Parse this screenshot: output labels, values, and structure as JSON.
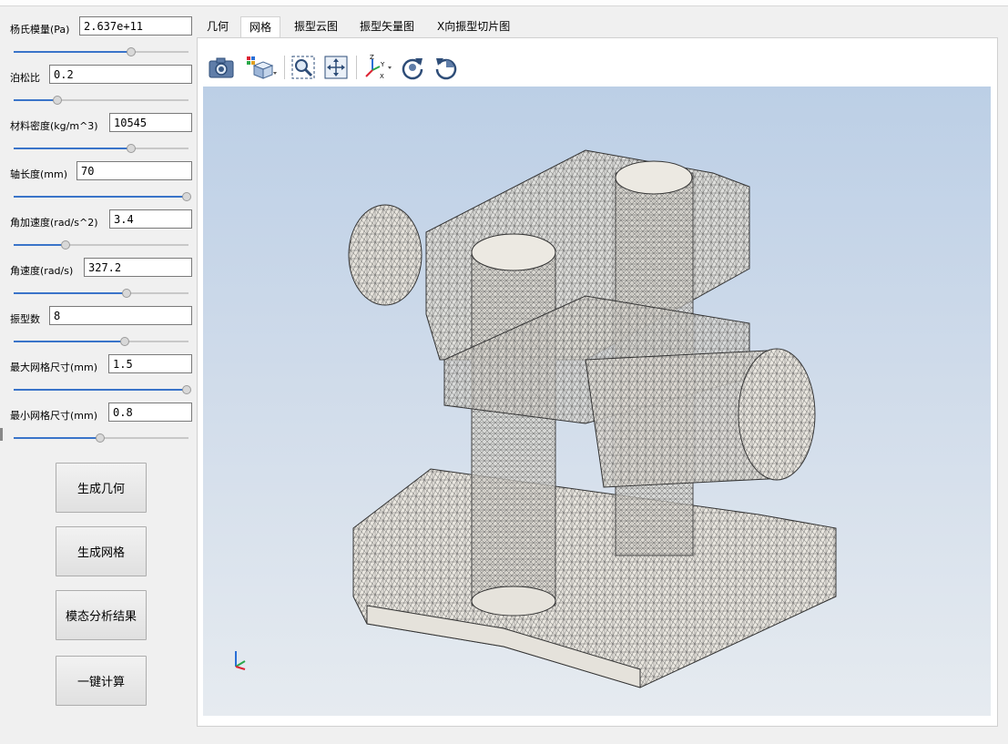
{
  "params": [
    {
      "label": "杨氏模量(Pa)",
      "value": "2.637e+11",
      "slider": 0.68
    },
    {
      "label": "泊松比",
      "value": "0.2",
      "slider": 0.25
    },
    {
      "label": "材料密度(kg/m^3)",
      "value": "10545",
      "slider": 0.68
    },
    {
      "label": "轴长度(mm)",
      "value": "70",
      "slider": 1.0
    },
    {
      "label": "角加速度(rad/s^2)",
      "value": "3.4",
      "slider": 0.3
    },
    {
      "label": "角速度(rad/s)",
      "value": "327.2",
      "slider": 0.65
    },
    {
      "label": "振型数",
      "value": "8",
      "slider": 0.64
    },
    {
      "label": "最大网格尺寸(mm)",
      "value": "1.5",
      "slider": 1.0
    },
    {
      "label": "最小网格尺寸(mm)",
      "value": "0.8",
      "slider": 0.5
    }
  ],
  "buttons": {
    "generate_geometry": "生成几何",
    "generate_mesh": "生成网格",
    "modal_results": "模态分析结果",
    "one_click": "一键计算"
  },
  "tabs": [
    {
      "label": "几何",
      "active": false
    },
    {
      "label": "网格",
      "active": true
    },
    {
      "label": "振型云图",
      "active": false
    },
    {
      "label": "振型矢量图",
      "active": false
    },
    {
      "label": "X向振型切片图",
      "active": false
    }
  ],
  "toolbar_icons": [
    "camera-icon",
    "view-cube-icon",
    "zoom-box-icon",
    "fit-all-icon",
    "axes-orientation-icon",
    "rotate-cw-icon",
    "rotate-ccw-icon"
  ],
  "colors": {
    "accent": "#3a74c9",
    "viewport_top": "#bccfe6",
    "viewport_bottom": "#e6ebf0",
    "mesh": "#555555"
  }
}
